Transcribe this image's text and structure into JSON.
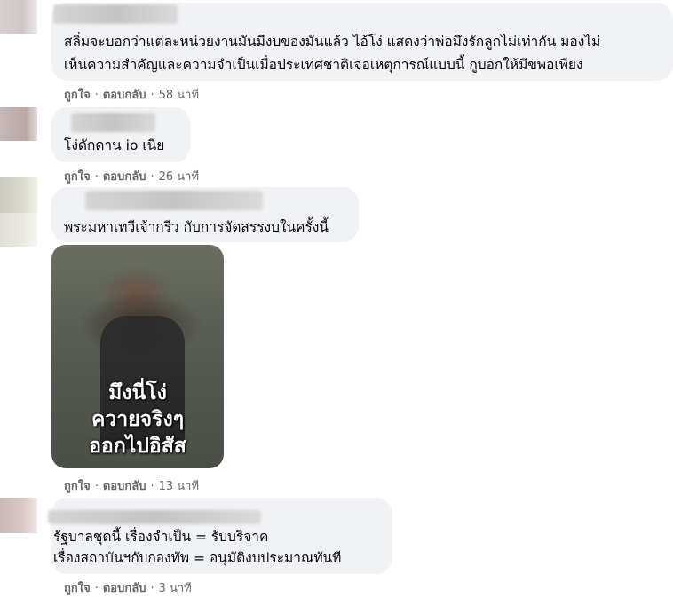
{
  "comments": [
    {
      "lines": [
        "สลิ่มจะบอกว่าแต่ละหน่วยงานมันมีงบของมันแล้ว ไอ้โง่ แสดงว่าพ่อมึงรักลูกไม่เท่ากัน มองไม่",
        "เห็นความสำคัญและความจำเป็นเมื่อประเทศชาติเจอเหตุการณ์แบบนี้ กูบอกให้มึขพอเพียง"
      ],
      "like": "ถูกใจ",
      "reply": "ตอบกลับ",
      "time": "58 นาที"
    },
    {
      "lines": [
        "โง่ดักดาน io เนี่ย"
      ],
      "like": "ถูกใจ",
      "reply": "ตอบกลับ",
      "time": "26 นาที"
    },
    {
      "lines": [
        "พระมหาเทวีเจ้ากรีว กับการจัดสรรงบในครั้งนี้"
      ],
      "media_caption": [
        "มึงนี่โง่",
        "ควายจริงๆ",
        "ออกไปอิสัส"
      ],
      "like": "ถูกใจ",
      "reply": "ตอบกลับ",
      "time": "13 นาที"
    },
    {
      "lines": [
        "รัฐบาลชุดนี้ เรื่องจำเป็น = รับบริจาค",
        "เรื่องสถาบันฯกับกองทัพ = อนุมัติงบประมาณทันที"
      ],
      "like": "ถูกใจ",
      "reply": "ตอบกลับ",
      "time": "3 นาที"
    }
  ]
}
